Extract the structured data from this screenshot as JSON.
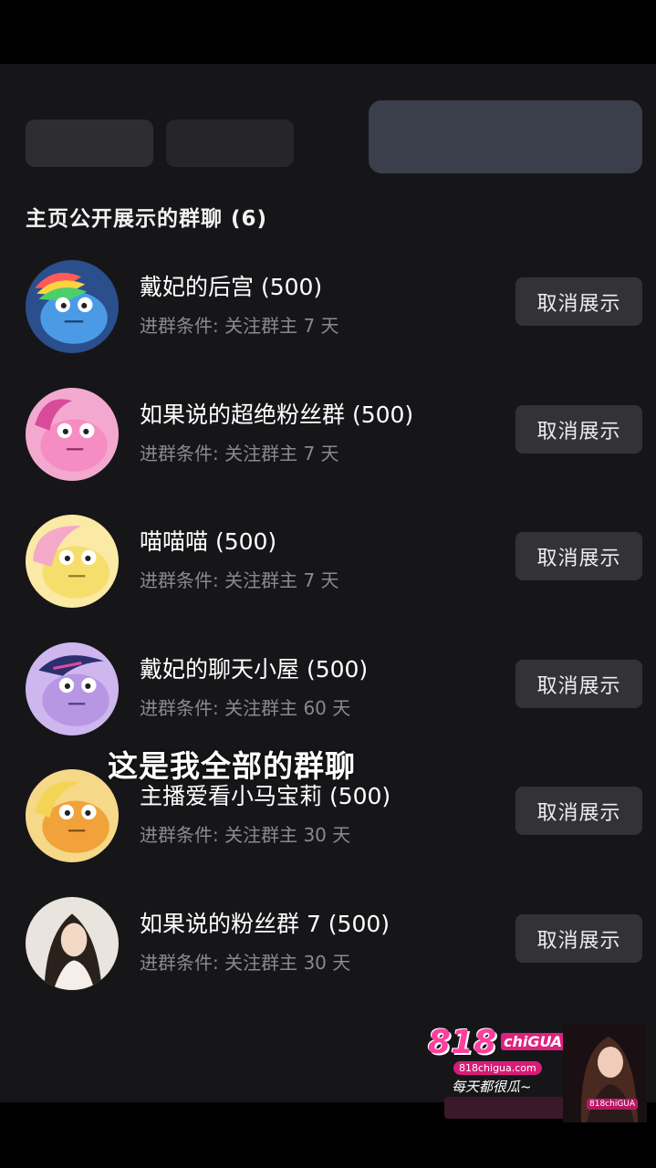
{
  "section": {
    "title": "主页公开展示的群聊 (6)"
  },
  "groups": [
    {
      "name": "戴妃的后宫 (500)",
      "condition": "进群条件: 关注群主 7 天",
      "button": "取消展示",
      "avatar_color": "#3f86d6"
    },
    {
      "name": "如果说的超绝粉丝群 (500)",
      "condition": "进群条件: 关注群主 7 天",
      "button": "取消展示",
      "avatar_color": "#f28ec4"
    },
    {
      "name": "喵喵喵 (500)",
      "condition": "进群条件: 关注群主 7 天",
      "button": "取消展示",
      "avatar_color": "#f6e27a"
    },
    {
      "name": "戴妃的聊天小屋 (500)",
      "condition": "进群条件: 关注群主 60 天",
      "button": "取消展示",
      "avatar_color": "#b99be0"
    },
    {
      "name": "主播爱看小马宝莉 (500)",
      "condition": "进群条件: 关注群主 30 天",
      "button": "取消展示",
      "avatar_color": "#f2a23a"
    },
    {
      "name": "如果说的粉丝群 7 (500)",
      "condition": "进群条件: 关注群主 30 天",
      "button": "取消展示",
      "avatar_color": "#d8d2cc"
    }
  ],
  "overlay": {
    "caption": "这是我全部的群聊"
  },
  "watermark": {
    "logo": "818",
    "logo_sub": "chiGUA",
    "url": "818chigua.com",
    "slogan": "每天都很瓜~",
    "tag": "818chiGUA"
  }
}
